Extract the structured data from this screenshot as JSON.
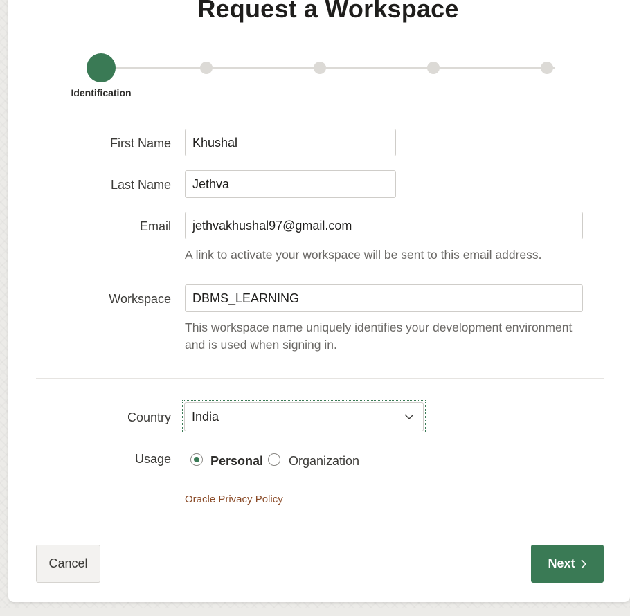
{
  "page": {
    "title": "Request a Workspace"
  },
  "progress": {
    "current_step": 1,
    "total_steps": 5,
    "active_label": "Identification"
  },
  "form": {
    "first_name": {
      "label": "First Name",
      "value": "Khushal"
    },
    "last_name": {
      "label": "Last Name",
      "value": "Jethva"
    },
    "email": {
      "label": "Email",
      "value": "jethvakhushal97@gmail.com",
      "help": "A link to activate your workspace will be sent to this email address."
    },
    "workspace": {
      "label": "Workspace",
      "value": "DBMS_LEARNING",
      "help_line1": "This workspace name uniquely identifies your development environment",
      "help_line2": "and is used when signing in."
    },
    "country": {
      "label": "Country",
      "value": "India"
    },
    "usage": {
      "label": "Usage",
      "options": [
        {
          "label": "Personal",
          "selected": true
        },
        {
          "label": "Organization",
          "selected": false
        }
      ]
    },
    "privacy_link": "Oracle Privacy Policy"
  },
  "buttons": {
    "cancel": "Cancel",
    "next": "Next"
  },
  "colors": {
    "accent": "#3a7a55",
    "link": "#8a4b28",
    "inactive_step": "#dcdad6"
  },
  "icons": {
    "select_arrow": "chevron-down-icon",
    "next_arrow": "chevron-right-icon"
  }
}
